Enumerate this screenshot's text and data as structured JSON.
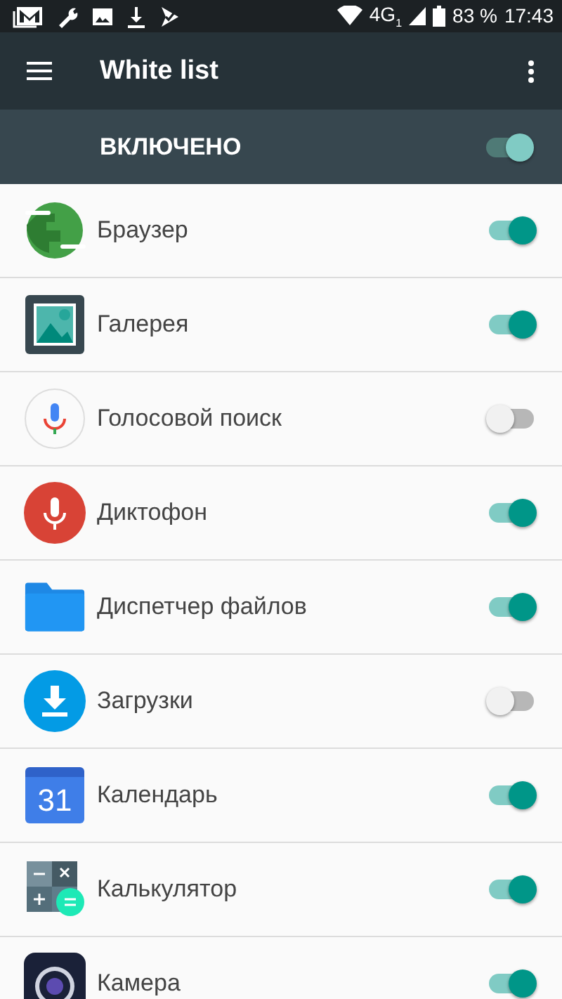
{
  "status_bar": {
    "network": "4G",
    "sim": "1",
    "battery": "83 %",
    "time": "17:43"
  },
  "toolbar": {
    "title": "White list"
  },
  "master_switch": {
    "label": "ВКЛЮЧЕНО",
    "on": true
  },
  "apps": [
    {
      "name": "Браузер",
      "kind": "browser",
      "on": true
    },
    {
      "name": "Галерея",
      "kind": "gallery",
      "on": true
    },
    {
      "name": "Голосовой поиск",
      "kind": "voice",
      "on": false
    },
    {
      "name": "Диктофон",
      "kind": "recorder",
      "on": true
    },
    {
      "name": "Диспетчер файлов",
      "kind": "files",
      "on": true
    },
    {
      "name": "Загрузки",
      "kind": "downloads",
      "on": false
    },
    {
      "name": "Календарь",
      "kind": "calendar",
      "on": true,
      "icon_text": "31"
    },
    {
      "name": "Калькулятор",
      "kind": "calculator",
      "on": true
    },
    {
      "name": "Камера",
      "kind": "camera",
      "on": true
    }
  ]
}
